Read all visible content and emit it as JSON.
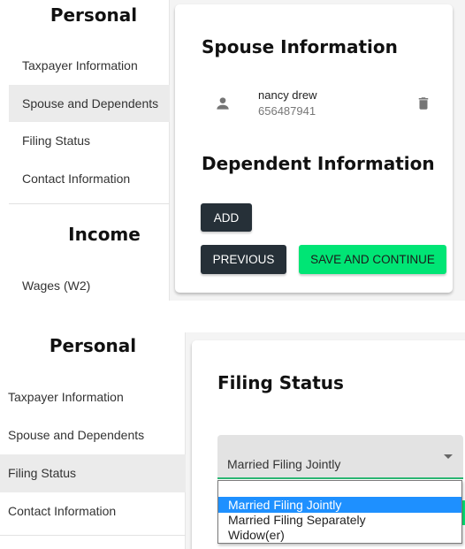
{
  "top_screen": {
    "sidebar": {
      "sections": [
        {
          "heading": "Personal",
          "items": [
            {
              "label": "Taxpayer Information",
              "active": false
            },
            {
              "label": "Spouse and Dependents",
              "active": true
            },
            {
              "label": "Filing Status",
              "active": false
            },
            {
              "label": "Contact Information",
              "active": false
            }
          ]
        },
        {
          "heading": "Income",
          "items": [
            {
              "label": "Wages (W2)",
              "active": false
            }
          ]
        }
      ]
    },
    "main": {
      "spouse_title": "Spouse Information",
      "spouse": {
        "name": "nancy drew",
        "ssn": "656487941",
        "icon": "person-icon",
        "delete_icon": "trash-icon"
      },
      "dependent_title": "Dependent Information",
      "add_label": "Add",
      "previous_label": "Previous",
      "save_label": "Save and Continue"
    }
  },
  "bottom_screen": {
    "sidebar": {
      "heading": "Personal",
      "items": [
        {
          "label": "Taxpayer Information",
          "active": false
        },
        {
          "label": "Spouse and Dependents",
          "active": false
        },
        {
          "label": "Filing Status",
          "active": true
        },
        {
          "label": "Contact Information",
          "active": false
        }
      ]
    },
    "main": {
      "title": "Filing Status",
      "select": {
        "value": "Married Filing Jointly",
        "options": [
          "",
          "Married Filing Jointly",
          "Married Filing Separately",
          "Widow(er)"
        ],
        "highlighted": "Married Filing Jointly"
      }
    }
  },
  "colors": {
    "dark_button": "#263038",
    "green_button": "#00e575",
    "active_nav": "#ebebeb",
    "select_focus_underline": "#2bb673",
    "option_highlight": "#1e90ff"
  }
}
